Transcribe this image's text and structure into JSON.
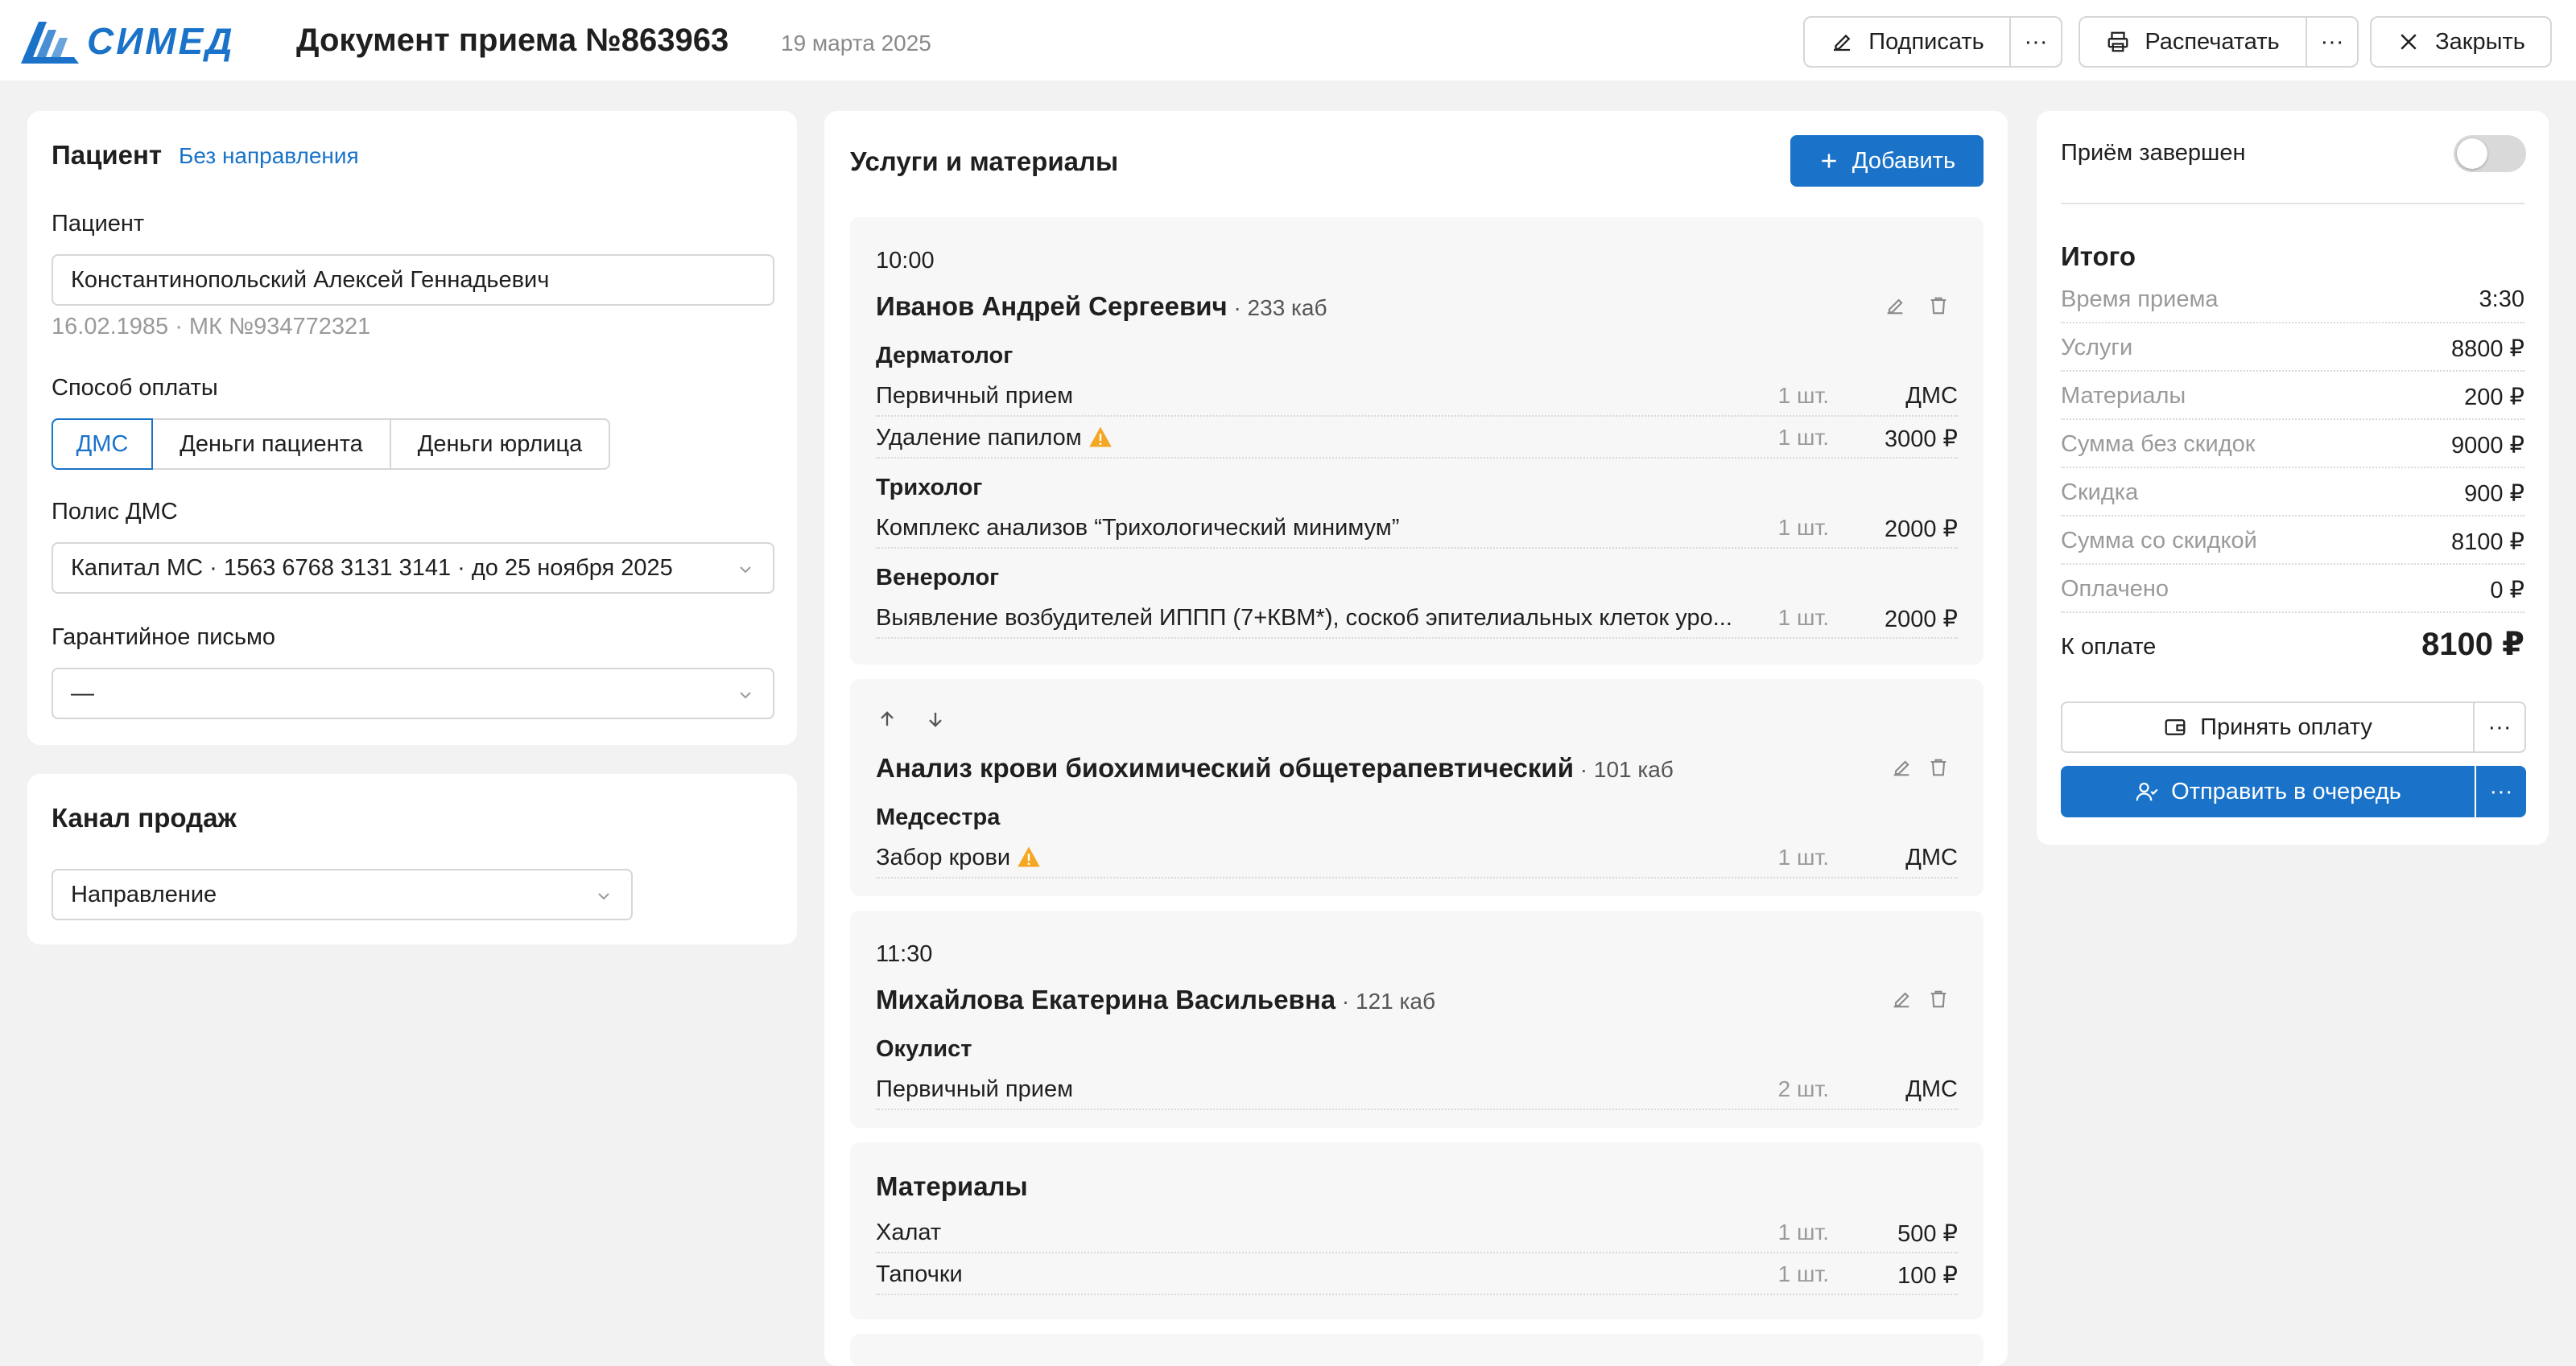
{
  "header": {
    "logo_text": "СИМЕД",
    "title": "Документ приема №863963",
    "date": "19 марта 2025",
    "sign_label": "Подписать",
    "more_label": "···",
    "print_label": "Распечатать",
    "close_label": "Закрыть"
  },
  "patient_card": {
    "heading": "Пациент",
    "referral_link": "Без направления",
    "patient_label": "Пациент",
    "patient_value": "Константинопольский Алексей Геннадьевич",
    "patient_meta": "16.02.1985 · МК №934772321",
    "payment_label": "Способ оплаты",
    "payment_options": [
      "ДМС",
      "Деньги пациента",
      "Деньги юрлица"
    ],
    "policy_label": "Полис ДМС",
    "policy_value": "Капитал МС · 1563 6768 3131 3141 · до 25 ноября 2025",
    "guarantee_label": "Гарантийное письмо",
    "guarantee_value": "—"
  },
  "sales_card": {
    "heading": "Канал продаж",
    "value": "Направление"
  },
  "services": {
    "heading": "Услуги и материалы",
    "add_label": "Добавить",
    "blocks": [
      {
        "time": "10:00",
        "name": "Иванов Андрей Сергеевич",
        "cab": " · 233 каб",
        "groups": [
          {
            "spec": "Дерматолог",
            "items": [
              {
                "name": "Первичный прием",
                "qty": "1 шт.",
                "price": "ДМС"
              },
              {
                "name": "Удаление папилом",
                "qty": "1 шт.",
                "price": "3000 ₽",
                "warn": true
              }
            ]
          },
          {
            "spec": "Трихолог",
            "items": [
              {
                "name": "Комплекс анализов “Трихологический минимум”",
                "qty": "1 шт.",
                "price": "2000 ₽"
              }
            ]
          },
          {
            "spec": "Венеролог",
            "items": [
              {
                "name": "Выявление возбудителей ИППП (7+КВМ*), соскоб эпителиальных клеток уро...",
                "qty": "1 шт.",
                "price": "2000 ₽"
              }
            ]
          }
        ]
      },
      {
        "name": "Анализ крови биохимический общетерапевтический",
        "cab": " · 101 каб",
        "groups": [
          {
            "spec": "Медсестра",
            "items": [
              {
                "name": "Забор крови",
                "qty": "1 шт.",
                "price": "ДМС",
                "warn": true
              }
            ]
          }
        ]
      },
      {
        "time": "11:30",
        "name": "Михайлова Екатерина Васильевна",
        "cab": " · 121 каб",
        "groups": [
          {
            "spec": "Окулист",
            "items": [
              {
                "name": "Первичный прием",
                "qty": "2 шт.",
                "price": "ДМС"
              }
            ]
          }
        ]
      }
    ],
    "materials": {
      "heading": "Материалы",
      "items": [
        {
          "name": "Халат",
          "qty": "1 шт.",
          "price": "500 ₽"
        },
        {
          "name": "Тапочки",
          "qty": "1 шт.",
          "price": "100 ₽"
        }
      ]
    }
  },
  "summary": {
    "completed_label": "Приём завершен",
    "completed": false,
    "total_heading": "Итого",
    "rows": [
      {
        "k": "Время приема",
        "v": "3:30"
      },
      {
        "k": "Услуги",
        "v": "8800 ₽"
      },
      {
        "k": "Материалы",
        "v": "200 ₽"
      },
      {
        "k": "Сумма без скидок",
        "v": "9000 ₽"
      },
      {
        "k": "Скидка",
        "v": "900 ₽"
      },
      {
        "k": "Сумма со скидкой",
        "v": "8100 ₽"
      },
      {
        "k": "Оплачено",
        "v": "0 ₽"
      }
    ],
    "to_pay_label": "К оплате",
    "to_pay_value": "8100 ₽",
    "accept_label": "Принять оплату",
    "queue_label": "Отправить в очередь",
    "more_label": "···"
  },
  "colors": {
    "accent": "#1a73c9",
    "warning": "#f5a623"
  }
}
